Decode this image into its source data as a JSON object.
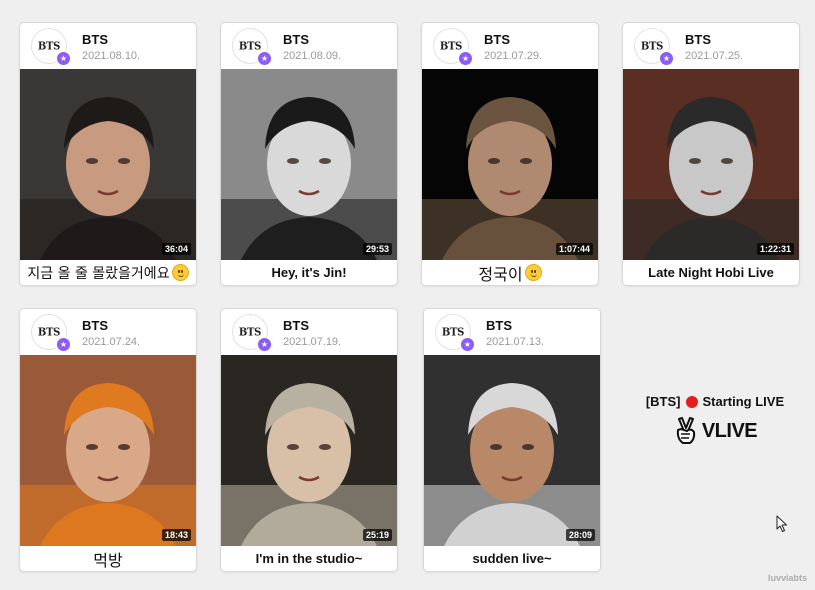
{
  "avatar_text": "BTS",
  "cards": [
    {
      "channel": "BTS",
      "date": "2021.08.10.",
      "duration": "36:04",
      "title": "지금 올 줄 몰랐을거에요",
      "emoji": true,
      "palette": [
        "#3a3836",
        "#c89a80",
        "#1e1a18"
      ]
    },
    {
      "channel": "BTS",
      "date": "2021.08.09.",
      "duration": "29:53",
      "title": "Hey, it's Jin!",
      "emoji": false,
      "palette": [
        "#8a8a8a",
        "#d9d9d9",
        "#1a1a1a"
      ]
    },
    {
      "channel": "BTS",
      "date": "2021.07.29.",
      "duration": "1:07:44",
      "title": "정국이",
      "emoji": true,
      "palette": [
        "#050505",
        "#b08a70",
        "#6b5540"
      ]
    },
    {
      "channel": "BTS",
      "date": "2021.07.25.",
      "duration": "1:22:31",
      "title": "Late Night Hobi Live",
      "emoji": false,
      "palette": [
        "#5a2e22",
        "#c8c8c8",
        "#2a2a2a"
      ]
    },
    {
      "channel": "BTS",
      "date": "2021.07.24.",
      "duration": "18:43",
      "title": "먹방",
      "emoji": false,
      "palette": [
        "#9a5a38",
        "#d8a888",
        "#e07a20"
      ]
    },
    {
      "channel": "BTS",
      "date": "2021.07.19.",
      "duration": "25:19",
      "title": "I'm in the studio~",
      "emoji": false,
      "palette": [
        "#2a2622",
        "#d8c0a8",
        "#b8b0a0"
      ]
    },
    {
      "channel": "BTS",
      "date": "2021.07.13.",
      "duration": "28:09",
      "title": "sudden live~",
      "emoji": false,
      "palette": [
        "#303030",
        "#b88868",
        "#d8d8d8"
      ]
    }
  ],
  "live": {
    "prefix": "[BTS]",
    "status": "Starting LIVE",
    "brand": "VLIVE"
  },
  "watermark": "luvviabts",
  "colors": {
    "verified": "#8b5cf6",
    "live_dot": "#e51d1d"
  }
}
